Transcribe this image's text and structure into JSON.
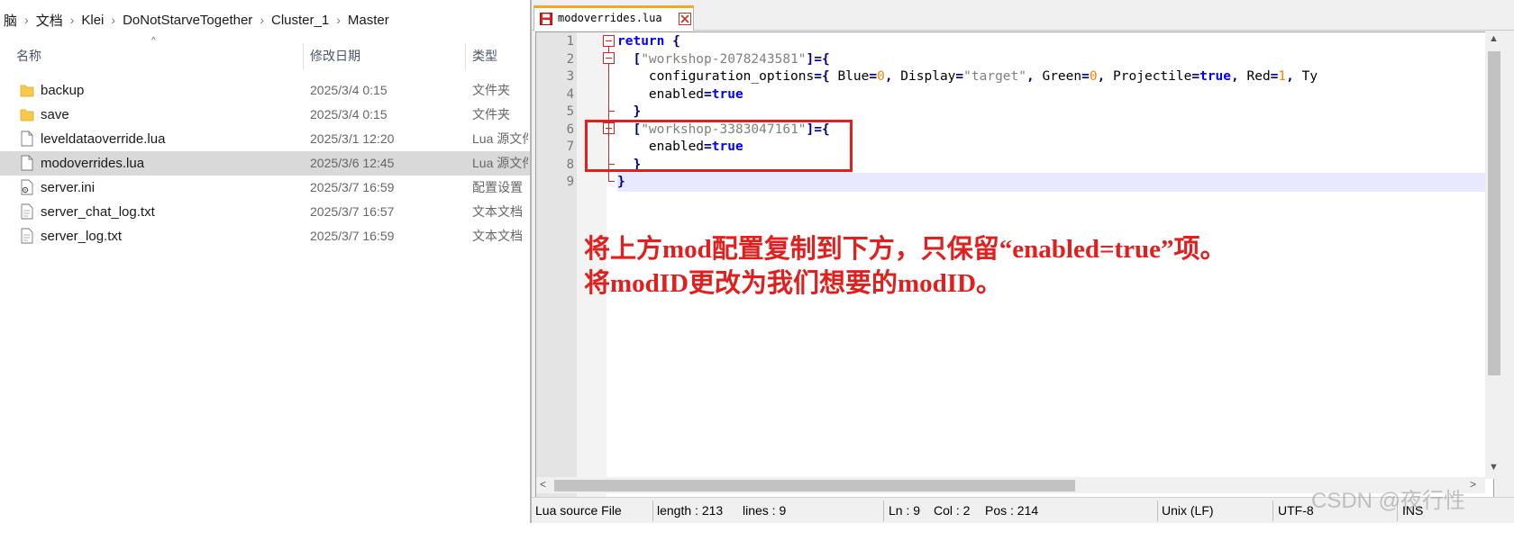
{
  "explorer": {
    "breadcrumb": [
      "脑",
      "文档",
      "Klei",
      "DoNotStarveTogether",
      "Cluster_1",
      "Master"
    ],
    "columns": {
      "name": "名称",
      "date": "修改日期",
      "type": "类型"
    },
    "sort_indicator": "^",
    "files": [
      {
        "name": "backup",
        "date": "2025/3/4 0:15",
        "type": "文件夹",
        "icon": "folder-icon"
      },
      {
        "name": "save",
        "date": "2025/3/4 0:15",
        "type": "文件夹",
        "icon": "folder-icon"
      },
      {
        "name": "leveldataoverride.lua",
        "date": "2025/3/1 12:20",
        "type": "Lua 源文件",
        "icon": "file-icon"
      },
      {
        "name": "modoverrides.lua",
        "date": "2025/3/6 12:45",
        "type": "Lua 源文件",
        "icon": "file-icon",
        "selected": true
      },
      {
        "name": "server.ini",
        "date": "2025/3/7 16:59",
        "type": "配置设置",
        "icon": "settings-file-icon"
      },
      {
        "name": "server_chat_log.txt",
        "date": "2025/3/7 16:57",
        "type": "文本文档",
        "icon": "file-icon"
      },
      {
        "name": "server_log.txt",
        "date": "2025/3/7 16:59",
        "type": "文本文档",
        "icon": "file-icon"
      }
    ]
  },
  "editor": {
    "tab": {
      "label": "modoverrides.lua"
    },
    "line_numbers": [
      "1",
      "2",
      "3",
      "4",
      "5",
      "6",
      "7",
      "8",
      "9"
    ],
    "code_lines": [
      {
        "tokens": [
          [
            "kw",
            "return"
          ],
          [
            "id",
            " "
          ],
          [
            "op",
            "{"
          ]
        ]
      },
      {
        "tokens": [
          [
            "id",
            "  "
          ],
          [
            "op",
            "["
          ],
          [
            "str",
            "\"workshop-2078243581\""
          ],
          [
            "op",
            "]={"
          ]
        ]
      },
      {
        "tokens": [
          [
            "id",
            "    configuration_options"
          ],
          [
            "op",
            "={"
          ],
          [
            "id",
            " Blue"
          ],
          [
            "op",
            "="
          ],
          [
            "num",
            "0"
          ],
          [
            "op",
            ","
          ],
          [
            "id",
            " Display"
          ],
          [
            "op",
            "="
          ],
          [
            "str",
            "\"target\""
          ],
          [
            "op",
            ","
          ],
          [
            "id",
            " Green"
          ],
          [
            "op",
            "="
          ],
          [
            "num",
            "0"
          ],
          [
            "op",
            ","
          ],
          [
            "id",
            " Projectile"
          ],
          [
            "op",
            "="
          ],
          [
            "kw",
            "true"
          ],
          [
            "op",
            ","
          ],
          [
            "id",
            " Red"
          ],
          [
            "op",
            "="
          ],
          [
            "num",
            "1"
          ],
          [
            "op",
            ","
          ],
          [
            "id",
            " Ty"
          ]
        ]
      },
      {
        "tokens": [
          [
            "id",
            "    enabled"
          ],
          [
            "op",
            "="
          ],
          [
            "kw",
            "true"
          ]
        ]
      },
      {
        "tokens": [
          [
            "id",
            "  "
          ],
          [
            "op",
            "}"
          ]
        ]
      },
      {
        "tokens": [
          [
            "id",
            "  "
          ],
          [
            "op",
            "["
          ],
          [
            "str",
            "\"workshop-3383047161\""
          ],
          [
            "op",
            "]={"
          ]
        ]
      },
      {
        "tokens": [
          [
            "id",
            "    enabled"
          ],
          [
            "op",
            "="
          ],
          [
            "kw",
            "true"
          ]
        ]
      },
      {
        "tokens": [
          [
            "id",
            "  "
          ],
          [
            "op",
            "}"
          ]
        ]
      },
      {
        "tokens": [
          [
            "op",
            "}"
          ]
        ]
      }
    ],
    "current_line": 9,
    "annotation": {
      "line1": "将上方mod配置复制到下方，只保留“enabled=true”项。",
      "line2": "将modID更改为我们想要的modID。"
    },
    "status": {
      "file_type": "Lua source File",
      "length": "length : 213",
      "lines": "lines : 9",
      "ln": "Ln : 9",
      "col": "Col : 2",
      "pos": "Pos : 214",
      "eol": "Unix (LF)",
      "encoding": "UTF-8",
      "mode": "INS"
    },
    "colors": {
      "keyword": "#0000ff",
      "operator": "#000080",
      "string": "#808080",
      "number": "#ff8000",
      "annotation": "#e0201e"
    }
  },
  "watermark": "CSDN @夜行性"
}
